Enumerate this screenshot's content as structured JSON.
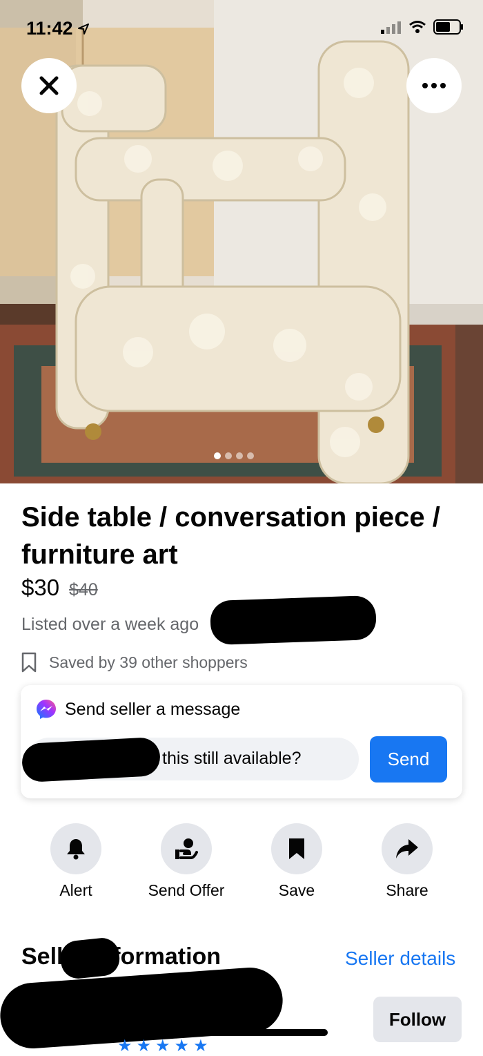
{
  "status_bar": {
    "time": "11:42"
  },
  "listing": {
    "title": "Side table / conversation piece / furniture art",
    "price": "$30",
    "original_price": "$40",
    "listed": "Listed over a week ago",
    "saved": "Saved by 39 other shoppers",
    "photo_count": 4,
    "photo_index": 1
  },
  "message_box": {
    "heading": "Send seller a message",
    "input_value": "this still available?",
    "send_label": "Send"
  },
  "actions": [
    {
      "label": "Alert",
      "icon": "bell-icon"
    },
    {
      "label": "Send Offer",
      "icon": "offer-icon"
    },
    {
      "label": "Save",
      "icon": "bookmark-icon"
    },
    {
      "label": "Share",
      "icon": "share-icon"
    }
  ],
  "seller": {
    "heading": "Seller information",
    "details_link": "Seller details",
    "follow_label": "Follow"
  },
  "colors": {
    "accent": "#1877f2",
    "secondary_text": "#65676b",
    "button_gray": "#e4e6eb"
  }
}
